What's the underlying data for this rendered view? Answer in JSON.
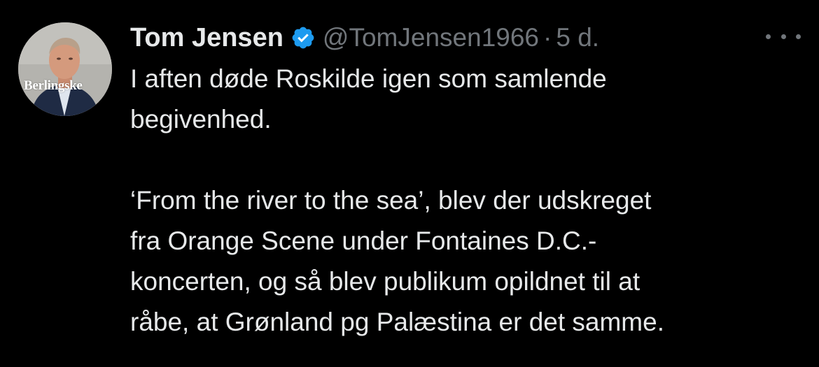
{
  "tweet": {
    "author": {
      "display_name": "Tom Jensen",
      "handle": "@TomJensen1966",
      "verified": true,
      "avatar_badge_text": "Berlingske"
    },
    "separator": "·",
    "timestamp": "5 d.",
    "more_icon": "more-horizontal-icon",
    "verified_icon": "verified-badge-icon",
    "body": {
      "lines_paragraph_1": [
        "I aften døde Roskilde igen som samlende",
        "begivenhed."
      ],
      "lines_paragraph_2": [
        "‘From the river to the sea’, blev der udskreget",
        "fra Orange Scene under Fontaines D.C.-",
        "koncerten, og så blev publikum opildnet til at",
        "råbe, at Grønland pg Palæstina er det samme."
      ]
    }
  },
  "colors": {
    "background": "#000000",
    "primary_text": "#e7e9ea",
    "secondary_text": "#71767b",
    "verified_blue": "#1d9bf0"
  }
}
